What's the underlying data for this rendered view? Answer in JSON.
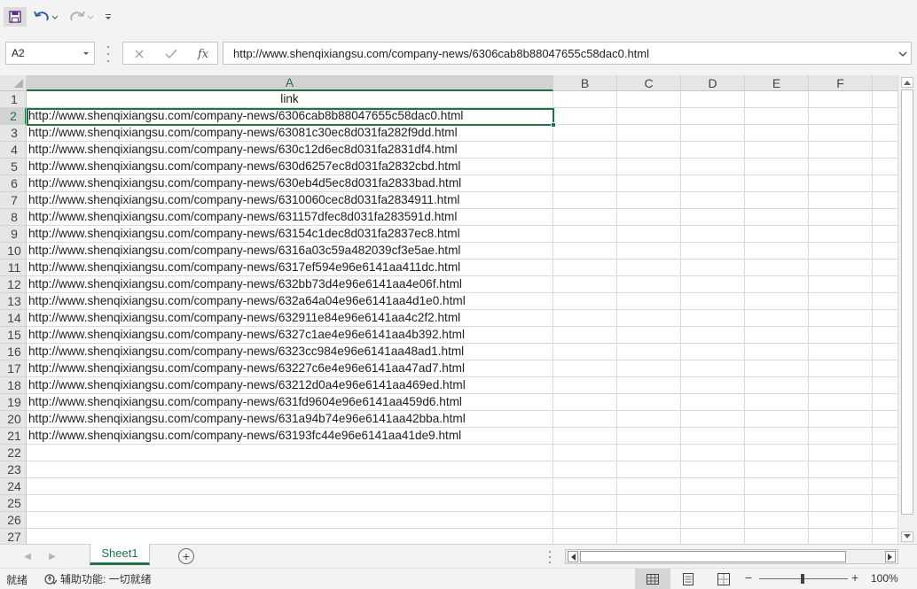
{
  "quick_access": {
    "save_icon": "save-icon",
    "undo_icon": "undo-icon",
    "redo_icon": "redo-icon",
    "customize_icon": "customize-toolbar-icon"
  },
  "formula_bar": {
    "name_box": "A2",
    "fx_label": "fx",
    "formula": "http://www.shenqixiangsu.com/company-news/6306cab8b88047655c58dac0.html"
  },
  "columns": [
    "A",
    "B",
    "C",
    "D",
    "E",
    "F"
  ],
  "selected_column": "A",
  "rows": [
    {
      "n": "1",
      "a": "link"
    },
    {
      "n": "2",
      "a": "http://www.shenqixiangsu.com/company-news/6306cab8b88047655c58dac0.html"
    },
    {
      "n": "3",
      "a": "http://www.shenqixiangsu.com/company-news/63081c30ec8d031fa282f9dd.html"
    },
    {
      "n": "4",
      "a": "http://www.shenqixiangsu.com/company-news/630c12d6ec8d031fa2831df4.html"
    },
    {
      "n": "5",
      "a": "http://www.shenqixiangsu.com/company-news/630d6257ec8d031fa2832cbd.html"
    },
    {
      "n": "6",
      "a": "http://www.shenqixiangsu.com/company-news/630eb4d5ec8d031fa2833bad.html"
    },
    {
      "n": "7",
      "a": "http://www.shenqixiangsu.com/company-news/6310060cec8d031fa2834911.html"
    },
    {
      "n": "8",
      "a": "http://www.shenqixiangsu.com/company-news/631157dfec8d031fa283591d.html"
    },
    {
      "n": "9",
      "a": "http://www.shenqixiangsu.com/company-news/63154c1dec8d031fa2837ec8.html"
    },
    {
      "n": "10",
      "a": "http://www.shenqixiangsu.com/company-news/6316a03c59a482039cf3e5ae.html"
    },
    {
      "n": "11",
      "a": "http://www.shenqixiangsu.com/company-news/6317ef594e96e6141aa411dc.html"
    },
    {
      "n": "12",
      "a": "http://www.shenqixiangsu.com/company-news/632bb73d4e96e6141aa4e06f.html"
    },
    {
      "n": "13",
      "a": "http://www.shenqixiangsu.com/company-news/632a64a04e96e6141aa4d1e0.html"
    },
    {
      "n": "14",
      "a": "http://www.shenqixiangsu.com/company-news/632911e84e96e6141aa4c2f2.html"
    },
    {
      "n": "15",
      "a": "http://www.shenqixiangsu.com/company-news/6327c1ae4e96e6141aa4b392.html"
    },
    {
      "n": "16",
      "a": "http://www.shenqixiangsu.com/company-news/6323cc984e96e6141aa48ad1.html"
    },
    {
      "n": "17",
      "a": "http://www.shenqixiangsu.com/company-news/63227c6e4e96e6141aa47ad7.html"
    },
    {
      "n": "18",
      "a": "http://www.shenqixiangsu.com/company-news/63212d0a4e96e6141aa469ed.html"
    },
    {
      "n": "19",
      "a": "http://www.shenqixiangsu.com/company-news/631fd9604e96e6141aa459d6.html"
    },
    {
      "n": "20",
      "a": "http://www.shenqixiangsu.com/company-news/631a94b74e96e6141aa42bba.html"
    },
    {
      "n": "21",
      "a": "http://www.shenqixiangsu.com/company-news/63193fc44e96e6141aa41de9.html"
    },
    {
      "n": "22",
      "a": ""
    },
    {
      "n": "23",
      "a": ""
    },
    {
      "n": "24",
      "a": ""
    },
    {
      "n": "25",
      "a": ""
    },
    {
      "n": "26",
      "a": ""
    },
    {
      "n": "27",
      "a": ""
    }
  ],
  "selected_row": "2",
  "sheets": {
    "active": "Sheet1",
    "add_label": "+"
  },
  "status": {
    "ready": "就绪",
    "accessibility": "辅助功能: 一切就绪",
    "zoom_minus": "−",
    "zoom_plus": "+",
    "zoom": "100%"
  },
  "colors": {
    "accent": "#217346",
    "header_bg": "#e6e6e6",
    "gridline": "#dadada"
  }
}
